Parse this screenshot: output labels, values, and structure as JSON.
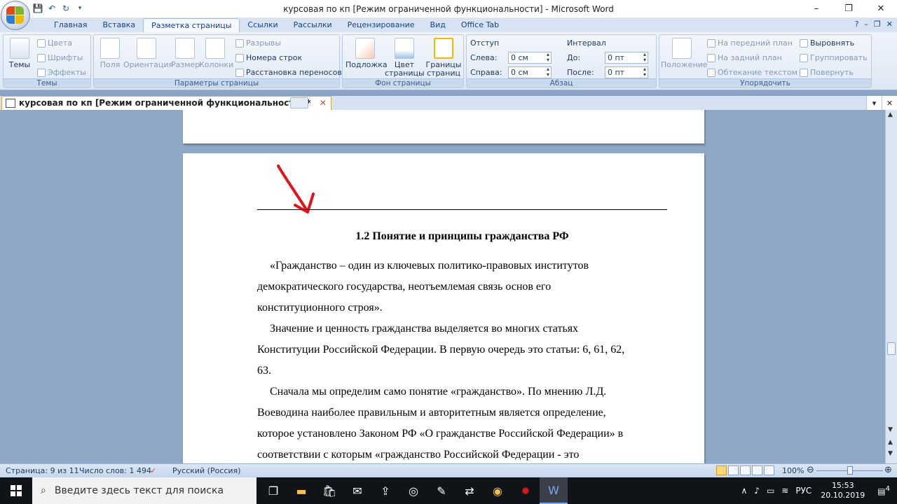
{
  "window": {
    "title": "курсовая по кп [Режим ограниченной функциональности] - Microsoft Word",
    "minimize": "–",
    "maximize": "❐",
    "close": "✕"
  },
  "qat": {
    "save": "💾",
    "undo": "↶",
    "redo": "↻",
    "more": "▾"
  },
  "ribbon_tabs": [
    "Главная",
    "Вставка",
    "Разметка страницы",
    "Ссылки",
    "Рассылки",
    "Рецензирование",
    "Вид",
    "Office Tab"
  ],
  "active_tab_index": 2,
  "ribbon": {
    "themes": {
      "label": "Темы",
      "big": "Темы",
      "colors": "Цвета",
      "fonts": "Шрифты",
      "effects": "Эффекты"
    },
    "page_setup": {
      "label": "Параметры страницы",
      "margins": "Поля",
      "orientation": "Ориентация",
      "size": "Размер",
      "columns": "Колонки",
      "breaks": "Разрывы",
      "line_numbers": "Номера строк",
      "hyphenation": "Расстановка переносов"
    },
    "page_background": {
      "label": "Фон страницы",
      "watermark": "Подложка",
      "page_color_l1": "Цвет",
      "page_color_l2": "страницы",
      "borders_l1": "Границы",
      "borders_l2": "страниц"
    },
    "paragraph": {
      "label": "Абзац",
      "indent_title": "Отступ",
      "left_label": "Слева:",
      "left_value": "0 см",
      "right_label": "Справа:",
      "right_value": "0 см",
      "spacing_title": "Интервал",
      "before_label": "До:",
      "before_value": "0 пт",
      "after_label": "После:",
      "after_value": "0 пт"
    },
    "arrange": {
      "label": "Упорядочить",
      "position": "Положение",
      "bring_front": "На передний план",
      "send_back": "На задний план",
      "text_wrap": "Обтекание текстом",
      "align": "Выровнять",
      "group": "Группировать",
      "rotate": "Повернуть"
    }
  },
  "doc_tab": {
    "title": "курсовая по кп [Режим ограниченной функциональности] *",
    "close": "✕"
  },
  "document": {
    "heading": "1.2 Понятие и принципы гражданства РФ",
    "lines": [
      {
        "text": "«Гражданство – один из ключевых  политико-правовых институтов",
        "indent": true
      },
      {
        "text": "демократического государства, неотъемлемая связь основ  его",
        "indent": false
      },
      {
        "text": "конституционного строя».",
        "indent": false
      },
      {
        "text": "Значение и ценность гражданства выделяется во многих статьях",
        "indent": true
      },
      {
        "text": "Конституции Российской Федерации. В первую очередь это статьи: 6, 61, 62,",
        "indent": false
      },
      {
        "text": "63.",
        "indent": false
      },
      {
        "text": "Сначала мы определим само понятие «гражданство». По мнению Л.Д.",
        "indent": true
      },
      {
        "text": "Воеводина наиболее правильным и авторитетным является определение,",
        "indent": false
      },
      {
        "text": "которое установлено Законом РФ «О гражданстве Российской Федерации» в",
        "indent": false
      },
      {
        "text": "соответствии с которым «гражданство Российской Федерации - это",
        "indent": false
      }
    ]
  },
  "status": {
    "page": "Страница: 9 из 11",
    "words": "Число слов: 1 494",
    "language": "Русский (Россия)",
    "zoom": "100%",
    "zoom_level": 0.5
  },
  "taskbar": {
    "search_placeholder": "Введите здесь текст для поиска",
    "lang": "РУС",
    "time": "15:53",
    "date": "20.10.2019",
    "notifications": "4"
  },
  "colors": {
    "accent": "#2b579a",
    "arrow": "#e0151b"
  }
}
